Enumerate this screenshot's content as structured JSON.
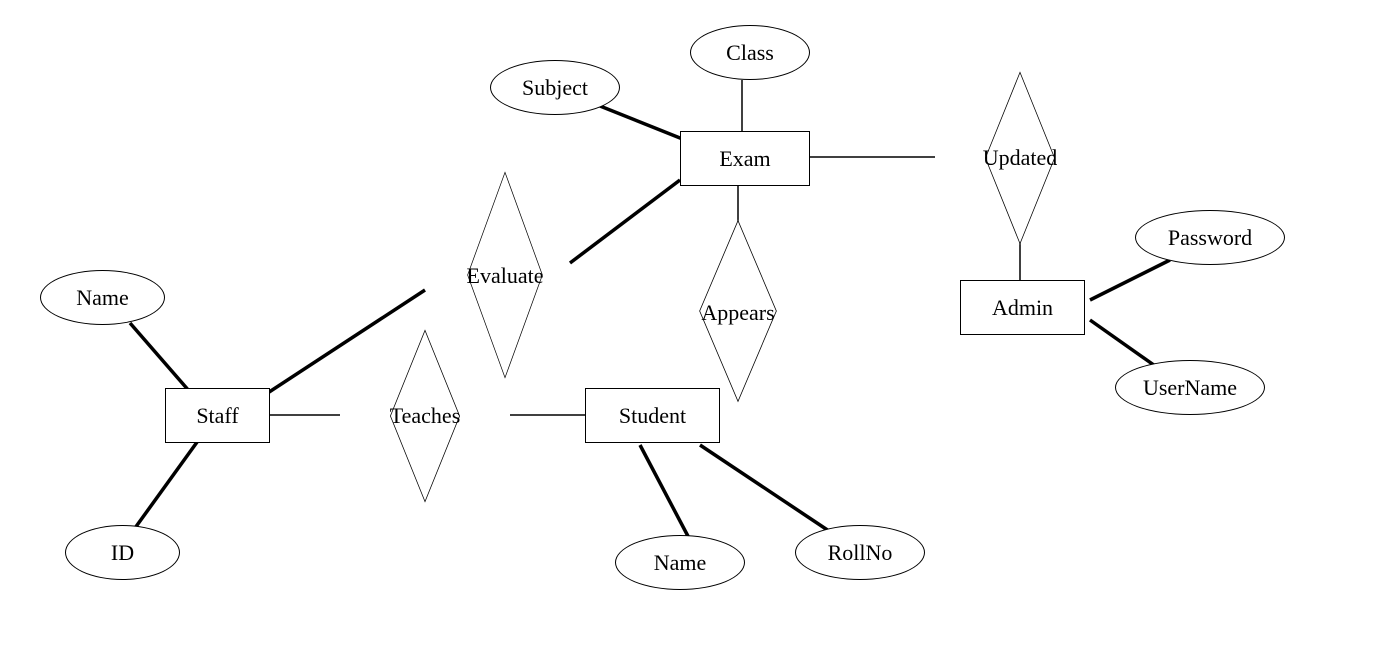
{
  "diagram_type": "entity-relationship",
  "entities": {
    "exam": {
      "label": "Exam"
    },
    "staff": {
      "label": "Staff"
    },
    "student": {
      "label": "Student"
    },
    "admin": {
      "label": "Admin"
    }
  },
  "relationships": {
    "updated": {
      "label": "Updated"
    },
    "evaluate": {
      "label": "Evaluate"
    },
    "appears": {
      "label": "Appears"
    },
    "teaches": {
      "label": "Teaches"
    }
  },
  "attributes": {
    "class": {
      "label": "Class"
    },
    "subject": {
      "label": "Subject"
    },
    "staff_name": {
      "label": "Name"
    },
    "staff_id": {
      "label": "ID"
    },
    "student_name": {
      "label": "Name"
    },
    "student_rollno": {
      "label": "RollNo"
    },
    "admin_password": {
      "label": "Password"
    },
    "admin_username": {
      "label": "UserName"
    }
  },
  "connections": [
    [
      "attributes.class",
      "entities.exam"
    ],
    [
      "attributes.subject",
      "entities.exam"
    ],
    [
      "entities.exam",
      "relationships.updated"
    ],
    [
      "relationships.updated",
      "entities.admin"
    ],
    [
      "entities.exam",
      "relationships.evaluate"
    ],
    [
      "relationships.evaluate",
      "entities.staff"
    ],
    [
      "entities.exam",
      "relationships.appears"
    ],
    [
      "attributes.staff_name",
      "entities.staff"
    ],
    [
      "attributes.staff_id",
      "entities.staff"
    ],
    [
      "entities.staff",
      "relationships.teaches"
    ],
    [
      "relationships.teaches",
      "entities.student"
    ],
    [
      "attributes.student_name",
      "entities.student"
    ],
    [
      "attributes.student_rollno",
      "entities.student"
    ],
    [
      "attributes.admin_password",
      "entities.admin"
    ],
    [
      "attributes.admin_username",
      "entities.admin"
    ]
  ]
}
